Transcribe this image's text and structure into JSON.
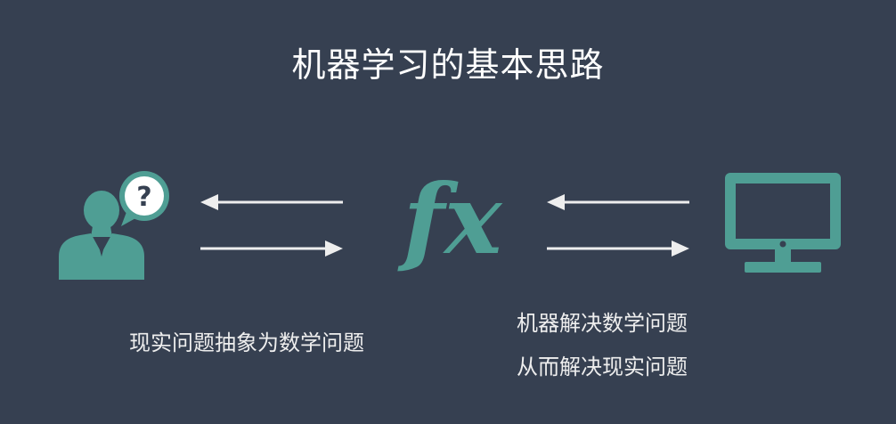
{
  "slide": {
    "title": "机器学习的基本思路",
    "formula_glyph": "fx",
    "question_glyph": "?",
    "captions": {
      "abstract": "现实问题抽象为数学问题",
      "solve_line1": "机器解决数学问题",
      "solve_line2": "从而解决现实问题"
    }
  },
  "colors": {
    "background": "#364051",
    "accent": "#4f9e94",
    "text": "#eeeeee",
    "title": "#ffffff"
  },
  "icons": [
    "person-question-icon",
    "function-icon",
    "monitor-icon"
  ]
}
